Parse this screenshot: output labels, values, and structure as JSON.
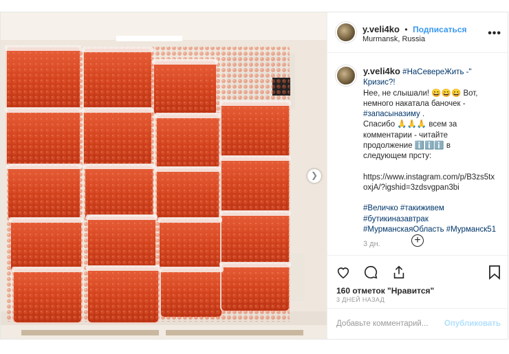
{
  "header": {
    "username": "y.veli4ko",
    "dot": "•",
    "follow_label": "Подписаться",
    "location": "Murmansk, Russia"
  },
  "caption": {
    "username": "y.veli4ko",
    "line1": "#НаСевереЖить -\" Кризис?!",
    "line2": "Нее, не слышали! 😄😄😄 Вот,",
    "line3": "немного накатала баночек -",
    "line4": "#запасыназиму .",
    "line5": "Спасибо 🙏🙏🙏 всем за",
    "line6": "комментарии - читайте",
    "line7": "продолжение ℹ️ℹ️ℹ️ в",
    "line8": "следующем прсту:",
    "link1": "https://www.instagram.com/p/B3zs5tx",
    "link2": "oxjA/?igshid=3zdsvgpan3bi",
    "tags1": "#Величко #такиживем",
    "tags2": "#бутикиназавтрак",
    "tags3": "#МурманскаяОбласть #Мурманск51",
    "time": "3 дн."
  },
  "actions": {
    "likes": "160 отметок \"Нравится\"",
    "ago": "3 ДНЕЙ НАЗАД"
  },
  "comment": {
    "placeholder": "Добавьте комментарий...",
    "publish": "Опубликовать"
  },
  "colors": {
    "accent": "#3897f0",
    "hashtag": "#003569",
    "caviar": "#d94a22"
  },
  "icons": [
    "heart-icon",
    "comment-icon",
    "share-icon",
    "bookmark-icon",
    "more-icon",
    "add-circle-icon",
    "chevron-right-icon"
  ]
}
